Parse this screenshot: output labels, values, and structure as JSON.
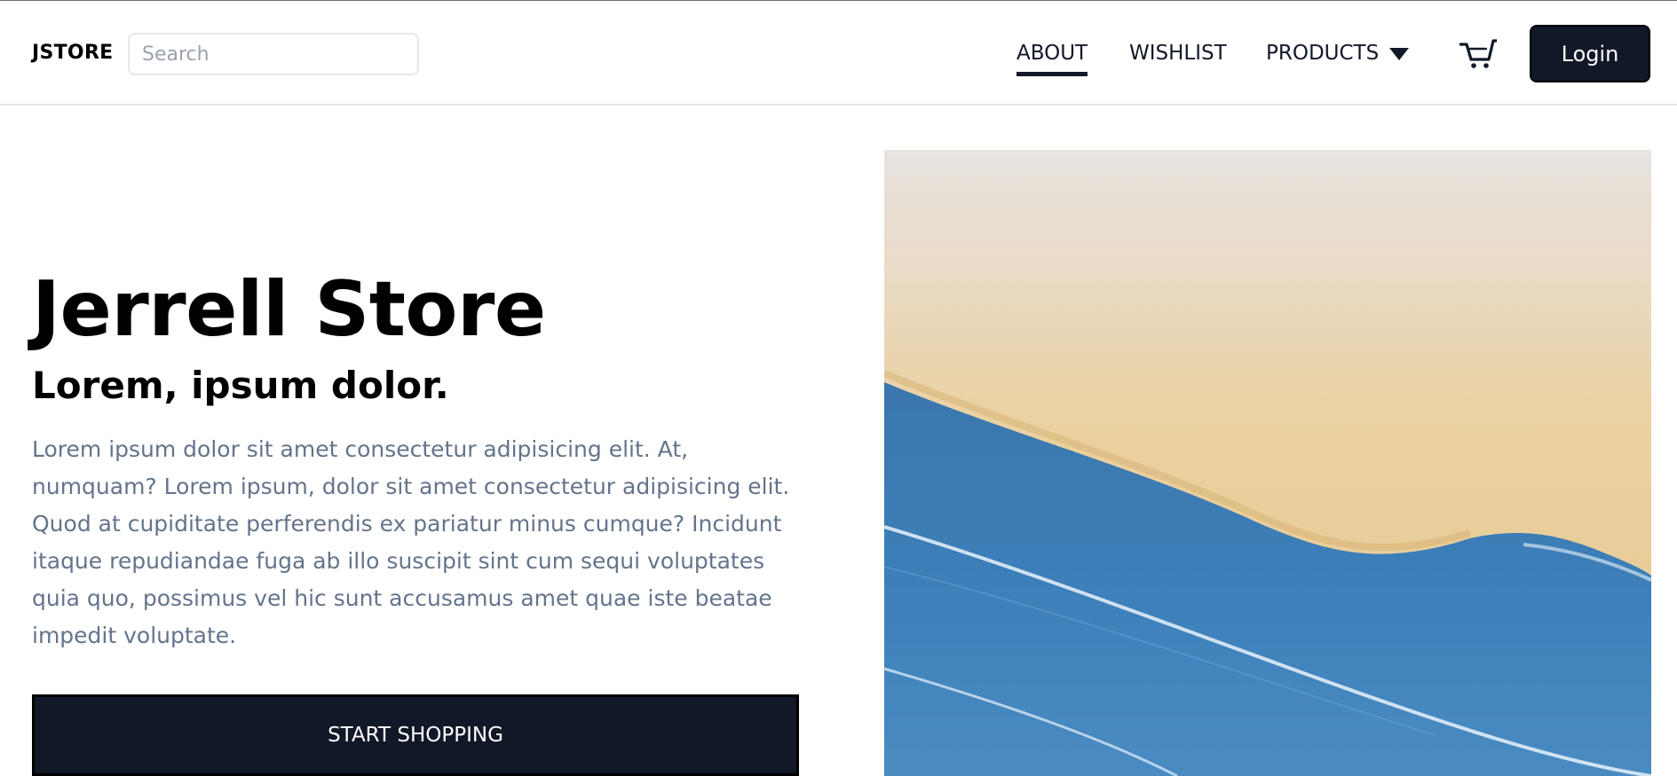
{
  "header": {
    "brand": "JSTORE",
    "search_placeholder": "Search",
    "nav": {
      "about": "ABOUT",
      "wishlist": "WISHLIST",
      "products": "PRODUCTS"
    },
    "active_nav": "ABOUT",
    "cart_icon": "cart-icon",
    "login_label": "Login"
  },
  "hero": {
    "title": "Jerrell Store",
    "subtitle": "Lorem, ipsum dolor.",
    "description": "Lorem ipsum dolor sit amet consectetur adipisicing elit. At, numquam? Lorem ipsum, dolor sit amet consectetur adipisicing elit. Quod at cupiditate perferendis ex pariatur minus cumque? Incidunt itaque repudiandae fuga ab illo suscipit sint cum sequi voluptates quia quo, possimus vel hic sunt accusamus amet quae iste beatae impedit voluptate.",
    "cta_label": "START SHOPPING",
    "image": "beach-aerial-photo"
  },
  "colors": {
    "primary": "#111827",
    "text_muted": "#64748b",
    "border": "#e5e7eb",
    "sand": "#e9cf9c",
    "sea": "#3f7fb8"
  }
}
